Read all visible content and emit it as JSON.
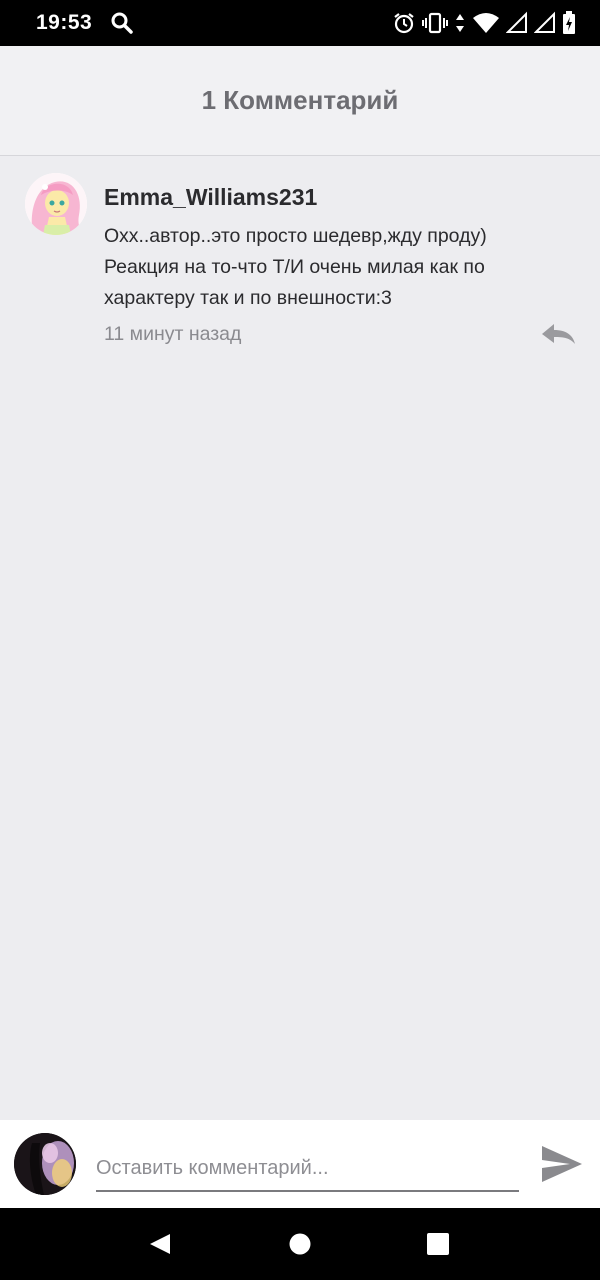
{
  "status_bar": {
    "time": "19:53",
    "icons": [
      "search-icon",
      "alarm-icon",
      "vibrate-icon",
      "data-arrows-icon",
      "wifi-icon",
      "signal-icon",
      "signal-icon",
      "battery-charging-icon"
    ]
  },
  "header": {
    "title": "1 Комментарий"
  },
  "comments": [
    {
      "author": "Emma_Williams231",
      "text": "Охх..автор..это просто шедевр,жду проду) Реакция на то-что Т/И очень милая как по характеру так и по внешности:3",
      "time": "11 минут назад",
      "avatar_icon": "avatar-pony-icon",
      "reply_icon": "reply-icon"
    }
  ],
  "composer": {
    "placeholder": "Оставить комментарий...",
    "value": "",
    "send_icon": "send-icon"
  },
  "nav_bar": {
    "icons": [
      "back-triangle-icon",
      "home-circle-icon",
      "recents-square-icon"
    ]
  },
  "colors": {
    "background": "#ededf0",
    "header_bg": "#f1f1f3",
    "text_primary": "#2b2b2e",
    "text_muted": "#8a8a8f",
    "icon_grey": "#9a9a9e"
  }
}
